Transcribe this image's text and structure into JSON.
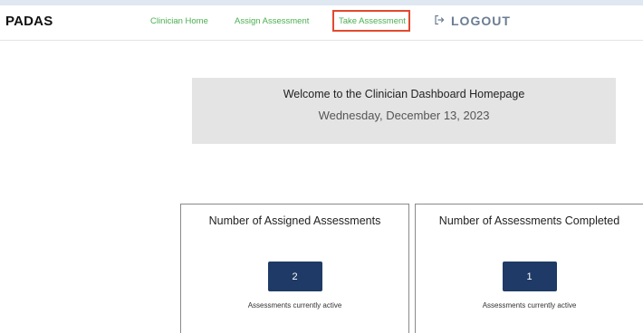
{
  "nav": {
    "brand": "PADAS",
    "clinician_home": "Clinician Home",
    "assign_assessment": "Assign Assessment",
    "take_assessment": "Take Assessment",
    "logout": "LOGOUT"
  },
  "welcome": {
    "title": "Welcome to the Clinician Dashboard Homepage",
    "date": "Wednesday, December 13, 2023"
  },
  "cards": [
    {
      "title": "Number of Assigned Assessments",
      "count": "2",
      "subtitle": "Assessments currently active"
    },
    {
      "title": "Number of Assessments Completed",
      "count": "1",
      "subtitle": "Assessments currently active"
    }
  ],
  "colors": {
    "nav_link": "#4caf50",
    "highlight": "#e2492e",
    "logout": "#6b7d93",
    "count_button": "#1f3a66",
    "welcome_bg": "#e4e4e4"
  },
  "icons": {
    "logout": "logout-icon"
  }
}
